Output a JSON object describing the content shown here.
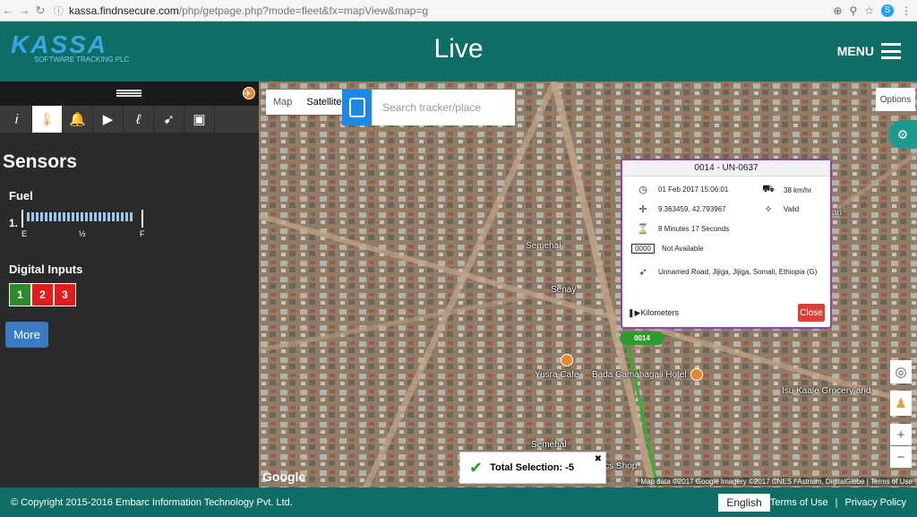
{
  "browser": {
    "url_host": "kassa.findnsecure.com",
    "url_path": "/php/getpage.php?mode=fleet&fx=mapView&map=g"
  },
  "header": {
    "logo_text": "KASSA",
    "logo_sub": "SOFTWARE TRACKING PLC",
    "title": "Live",
    "menu_label": "MENU"
  },
  "sidebar": {
    "section_title": "Sensors",
    "fuel_label": "Fuel",
    "fuel_index": "1.",
    "fuel_level": 0.92,
    "gauge_labels": [
      "E",
      "½",
      "F"
    ],
    "digital_inputs_label": "Digital Inputs",
    "digital_inputs": [
      "1",
      "2",
      "3"
    ],
    "more_label": "More"
  },
  "map": {
    "tab_map": "Map",
    "tab_satellite": "Satellite",
    "search_placeholder": "Search tracker/place",
    "options_label": "Options",
    "places": [
      "Semehal",
      "Senay",
      "Yusra Cafe",
      "Bada Camahagali Hotel",
      "Isu Kaale Grocery and",
      "Semehal",
      "ics Shop",
      "an"
    ],
    "vehicle_label": "0014",
    "attribution": "Map data ©2017 Google Imagery ©2017 CNES / Astrium, DigitalGlobe | Terms of Use",
    "google": "Google"
  },
  "popup": {
    "title": "0014 - UN-0637",
    "datetime": "01 Feb 2017 15:06:01",
    "speed": "38 km/hr",
    "coords": "9.363459, 42.793967",
    "gps": "Valid",
    "duration": "8 Minutes 17 Seconds",
    "odometer": "Not Available",
    "address": "Unnamed Road, Jijiga, Jijiga, Somali, Ethiopia (G)",
    "km_label": "Kilometers",
    "close_label": "Close"
  },
  "toast": {
    "text": "Total Selection:  -5"
  },
  "footer": {
    "copyright": "© Copyright 2015-2016 Embarc Information Technology Pvt. Ltd.",
    "language": "English",
    "terms": "Terms of Use",
    "separator": "|",
    "privacy": "Privacy Policy"
  }
}
